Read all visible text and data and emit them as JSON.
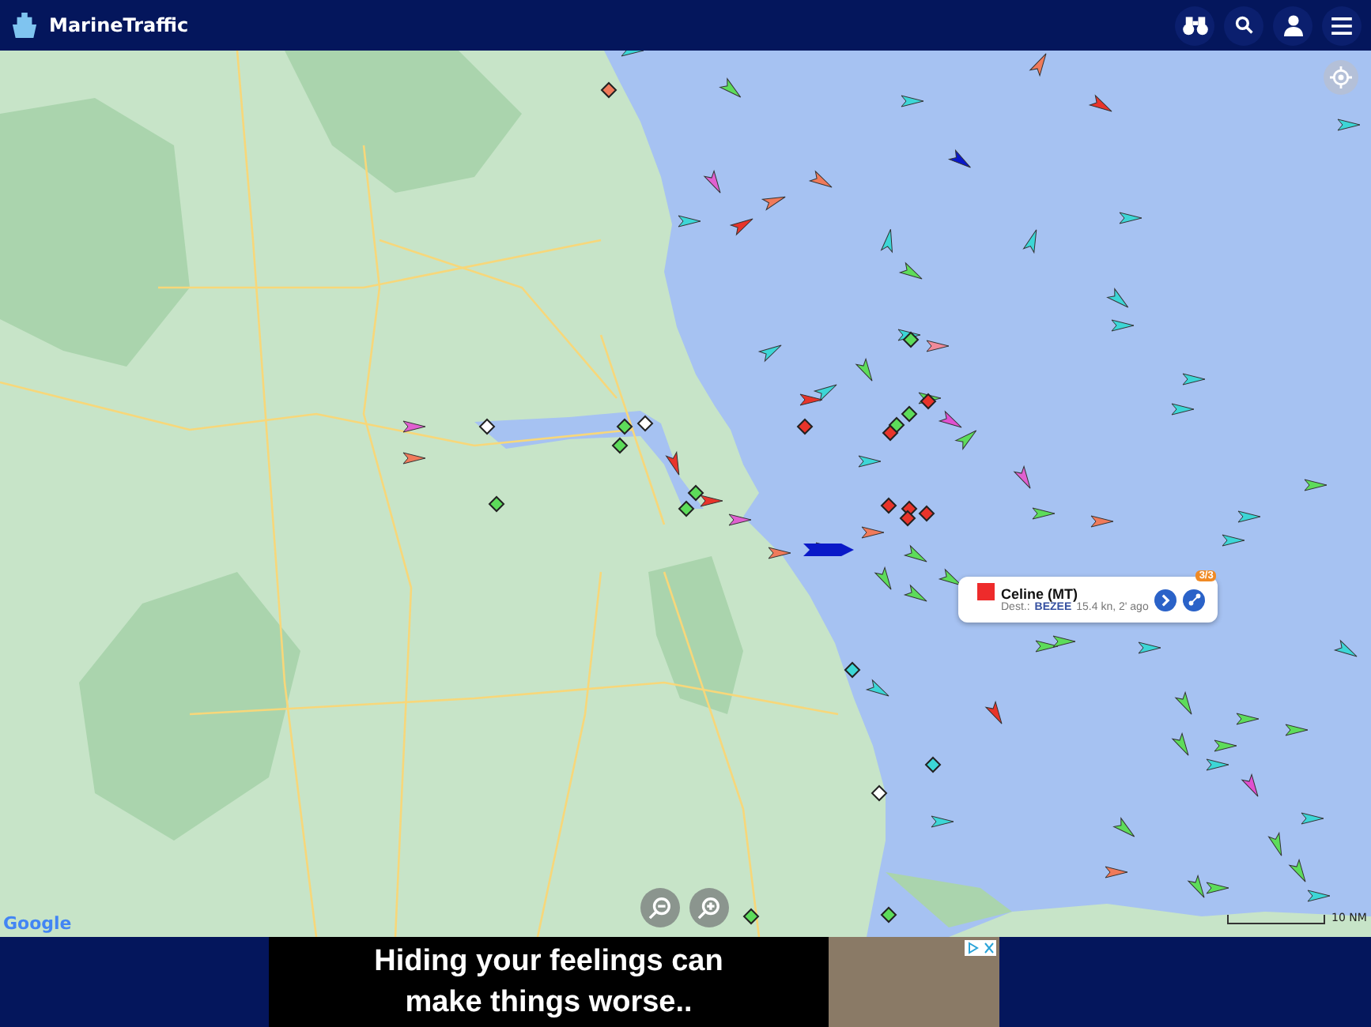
{
  "header": {
    "brand": "MarineTraffic"
  },
  "map": {
    "attribution": "Google",
    "scale_label": "10 NM"
  },
  "vessel_popup": {
    "name": "Celine (MT)",
    "destination_label": "Dest.:",
    "destination": "BEZEE",
    "speed_and_time": "15.4 kn, 2' ago",
    "badge": "3/3"
  },
  "ad": {
    "lines": [
      "Hiding your feelings can",
      "make things worse.."
    ]
  }
}
